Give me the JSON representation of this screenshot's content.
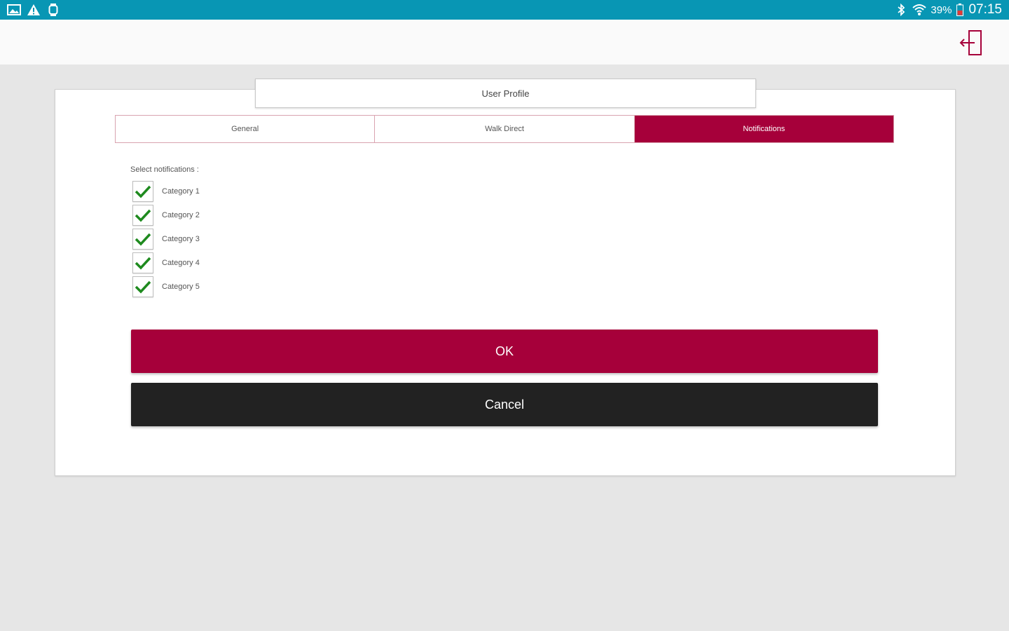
{
  "status_bar": {
    "battery_percent": "39%",
    "time": "07:15",
    "left_icons": [
      "image-icon",
      "warning-icon",
      "watch-icon"
    ],
    "right_icons": [
      "bluetooth-icon",
      "wifi-icon",
      "battery-icon"
    ]
  },
  "app_bar": {
    "logout_icon": "logout-icon"
  },
  "dialog": {
    "title": "User Profile",
    "tabs": [
      {
        "label": "General",
        "active": false
      },
      {
        "label": "Walk Direct",
        "active": false
      },
      {
        "label": "Notifications",
        "active": true
      }
    ],
    "select_label": "Select notifications :",
    "categories": [
      {
        "label": "Category 1",
        "checked": true
      },
      {
        "label": "Category 2",
        "checked": true
      },
      {
        "label": "Category 3",
        "checked": true
      },
      {
        "label": "Category 4",
        "checked": true
      },
      {
        "label": "Category 5",
        "checked": true
      }
    ],
    "ok_label": "OK",
    "cancel_label": "Cancel"
  },
  "colors": {
    "status_bar": "#0896b4",
    "accent": "#a6003a",
    "cancel": "#222222",
    "check": "#1e8a1e",
    "background": "#e6e6e6"
  }
}
